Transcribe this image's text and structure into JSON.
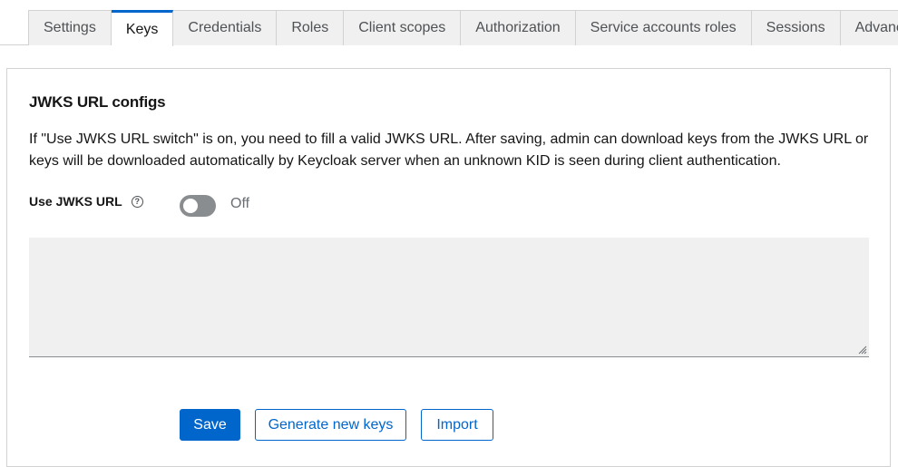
{
  "tabs": [
    {
      "label": "Settings",
      "active": false
    },
    {
      "label": "Keys",
      "active": true
    },
    {
      "label": "Credentials",
      "active": false
    },
    {
      "label": "Roles",
      "active": false
    },
    {
      "label": "Client scopes",
      "active": false
    },
    {
      "label": "Authorization",
      "active": false
    },
    {
      "label": "Service accounts roles",
      "active": false
    },
    {
      "label": "Sessions",
      "active": false
    },
    {
      "label": "Advanced",
      "active": false
    }
  ],
  "section": {
    "title": "JWKS URL configs",
    "description": "If \"Use JWKS URL switch\" is on, you need to fill a valid JWKS URL. After saving, admin can download keys from the JWKS URL or keys will be downloaded automatically by Keycloak server when an unknown KID is seen during client authentication."
  },
  "use_jwks_url": {
    "label": "Use JWKS URL",
    "help_icon": "question-circle-icon",
    "state_label": "Off",
    "enabled": false
  },
  "certificate": {
    "value": ""
  },
  "buttons": {
    "save": "Save",
    "generate": "Generate new keys",
    "import": "Import"
  },
  "colors": {
    "primary": "#0066cc",
    "switch_off": "#8a8d90",
    "field_bg": "#f0f0f0"
  }
}
